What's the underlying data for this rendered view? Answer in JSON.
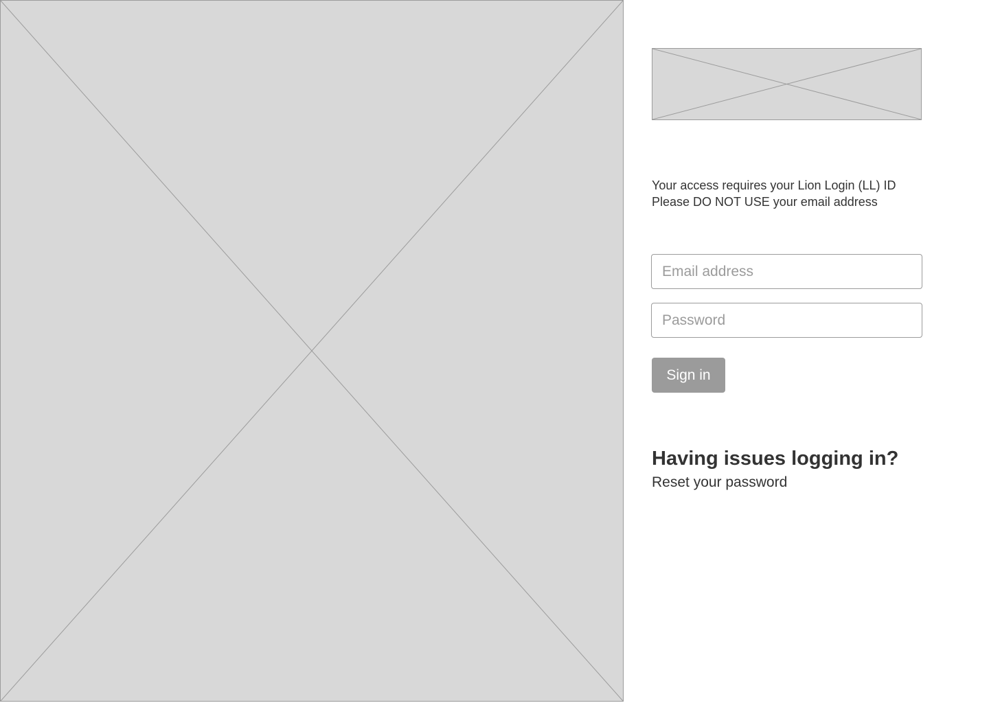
{
  "images": {
    "hero_icon": "image-placeholder-icon",
    "logo_icon": "image-placeholder-icon"
  },
  "notice": {
    "line1": "Your access requires your Lion Login (LL) ID",
    "line2": "Please DO NOT USE your email address"
  },
  "form": {
    "email_placeholder": "Email address",
    "email_value": "",
    "password_placeholder": "Password",
    "password_value": "",
    "signin_label": "Sign in"
  },
  "help": {
    "heading": "Having issues logging in?",
    "reset_link": "Reset your password"
  },
  "colors": {
    "placeholder_fill": "#d8d8d8",
    "border": "#9b9b9b",
    "button": "#9b9b9b",
    "text": "#333333"
  }
}
